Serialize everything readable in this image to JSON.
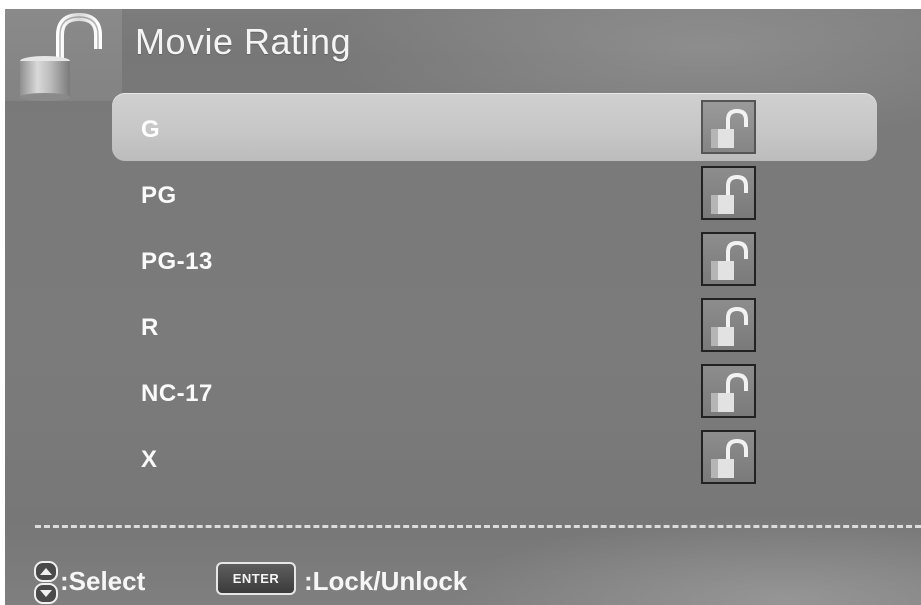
{
  "header": {
    "title": "Movie Rating",
    "icon": "padlock-icon"
  },
  "ratings": [
    {
      "label": "G",
      "status": "unlocked",
      "selected": true
    },
    {
      "label": "PG",
      "status": "unlocked",
      "selected": false
    },
    {
      "label": "PG-13",
      "status": "unlocked",
      "selected": false
    },
    {
      "label": "R",
      "status": "unlocked",
      "selected": false
    },
    {
      "label": "NC-17",
      "status": "unlocked",
      "selected": false
    },
    {
      "label": "X",
      "status": "unlocked",
      "selected": false
    }
  ],
  "footer": {
    "nav_icon": "up-down-arrows-icon",
    "select_text": ":Select",
    "enter_key": "ENTER",
    "lock_text": ":Lock/Unlock"
  },
  "colors": {
    "background": "#7b7b7b",
    "highlight": "#c9c9c9",
    "text": "#fafafa"
  }
}
